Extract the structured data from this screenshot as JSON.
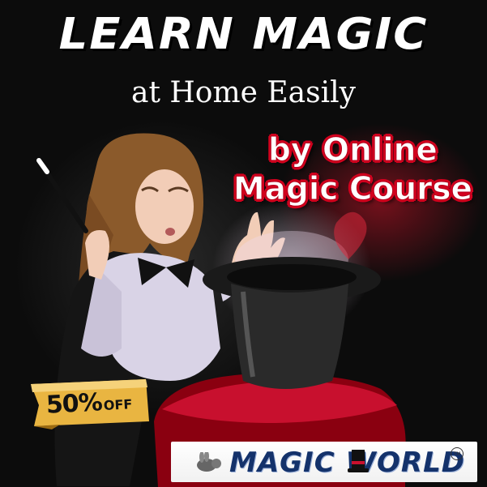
{
  "headline": "LEARN MAGIC",
  "subhead": "at Home Easily",
  "tagline": {
    "line1": "by Online",
    "line2": "Magic Course"
  },
  "badge": {
    "percent": "50%",
    "off": "OFF"
  },
  "brand": {
    "name": "MAGIC WORLD",
    "trademark": "TM"
  },
  "colors": {
    "accent_red": "#d3001e",
    "badge_gold": "#e9b541",
    "brand_blue": "#14326b"
  },
  "icons": {
    "magic_hat": "top-hat-icon",
    "rabbit": "rabbit-icon"
  }
}
